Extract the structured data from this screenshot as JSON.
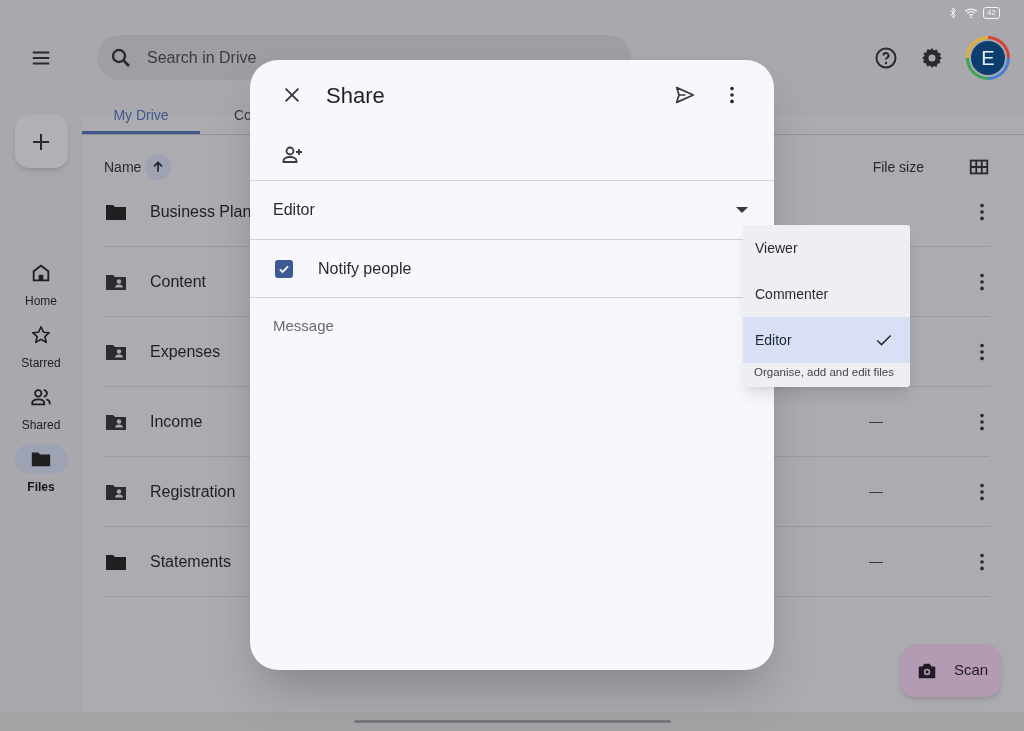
{
  "status_bar": {
    "battery": "42"
  },
  "top_bar": {
    "search": {
      "placeholder": "Search in Drive"
    },
    "avatar": "E"
  },
  "tabs": [
    {
      "label": "My Drive",
      "selected": true
    },
    {
      "label": "Co",
      "selected": false
    }
  ],
  "columns": [
    {
      "label": "Name",
      "sorted": true
    },
    {
      "label": "File size",
      "sorted": false
    }
  ],
  "rows": [
    {
      "name": "Business Plan",
      "kind": "folder"
    },
    {
      "name": "Content",
      "kind": "shared"
    },
    {
      "name": "Expenses",
      "kind": "shared"
    },
    {
      "name": "Income",
      "kind": "shared",
      "size": "—"
    },
    {
      "name": "Registration",
      "kind": "shared",
      "size": "—"
    },
    {
      "name": "Statements",
      "kind": "folder",
      "size": "—"
    }
  ],
  "nav": [
    {
      "label": "Home",
      "kind": "home",
      "selected": false
    },
    {
      "label": "Starred",
      "kind": "star",
      "selected": false
    },
    {
      "label": "Shared",
      "kind": "people",
      "selected": false
    },
    {
      "label": "Files",
      "kind": "folder",
      "selected": true
    }
  ],
  "scan_button": {
    "label": "Scan"
  },
  "dialog": {
    "title": "Share",
    "role": "Editor",
    "notify": {
      "label": "Notify people",
      "checked": true
    },
    "message": {
      "placeholder": "Message"
    }
  },
  "role_menu": [
    {
      "label": "Viewer",
      "selected": false
    },
    {
      "label": "Commenter",
      "selected": false
    },
    {
      "label": "Editor",
      "selected": true,
      "description": "Organise, add and edit files"
    }
  ]
}
